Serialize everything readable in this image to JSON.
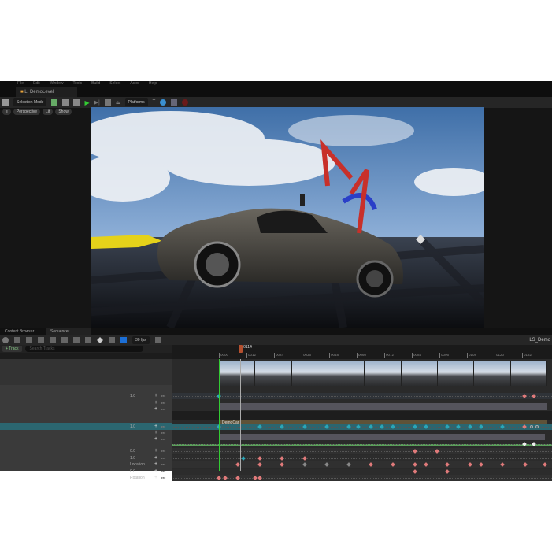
{
  "menu": [
    "File",
    "Edit",
    "Window",
    "Tools",
    "Build",
    "Select",
    "Actor",
    "Help"
  ],
  "level_tab": "L_DemoLevel",
  "toolbar": {
    "mode": "Selection Mode",
    "platforms": "Platforms"
  },
  "viewport_bar": {
    "perspective": "Perspective",
    "lit": "Lit",
    "show": "Show"
  },
  "lower_tabs": {
    "content_browser": "Content Browser",
    "sequencer": "Sequencer"
  },
  "sequencer": {
    "add_track": "+ Track",
    "search_placeholder": "Search Tracks",
    "fps": "30 fps",
    "sequence_name": "LS_Demo",
    "playhead_label": "0114",
    "playhead_frame": 6.5,
    "bar_label": "DemoCar"
  },
  "ruler_ticks": [
    "0000",
    "0012",
    "0024",
    "0036",
    "0048",
    "0060",
    "0072",
    "0084",
    "0096",
    "0108",
    "0120",
    "0132"
  ],
  "tree_rows": [
    {
      "label": "1.0"
    },
    {
      "label": ""
    },
    {
      "label": ""
    },
    {
      "label": "1.0"
    },
    {
      "label": ""
    },
    {
      "label": ""
    },
    {
      "label": "0.0"
    },
    {
      "label": "1.0"
    },
    {
      "label": "Location"
    },
    {
      "label": "0.0"
    },
    {
      "label": "Rotation"
    }
  ],
  "keys": {
    "camera_row": {
      "teal": [
        0
      ],
      "red": [
        93,
        96
      ]
    },
    "car_row": {
      "teal": [
        0,
        12.5,
        19.2,
        26.1,
        32.8,
        39.6,
        42.4,
        46.3,
        49.6,
        53,
        59.7,
        63.1,
        69.5,
        72.9,
        76.5,
        79.9,
        86.3
      ],
      "red": [
        93
      ],
      "circle": [
        95.2,
        96.9
      ]
    },
    "green_row": {
      "white": [
        93,
        96
      ]
    },
    "row_a": {
      "red": [
        59.7,
        66.4
      ]
    },
    "row_b": {
      "teal": [
        7.4
      ],
      "red": [
        12.5,
        19.2,
        26.1
      ]
    },
    "row_c": {
      "red": [
        5.8,
        12.5,
        19.2,
        46.3,
        53,
        59.7,
        63.1,
        69.5,
        76.5,
        79.9,
        86.3,
        93.3,
        99.3
      ],
      "gray": [
        26.1,
        32.8,
        39.6
      ]
    },
    "row_d": {
      "red": [
        59.7,
        69.5
      ]
    },
    "row_e": {
      "red": [
        0,
        1.8,
        5.8,
        11.1,
        12.5
      ]
    }
  },
  "colors": {
    "teal": "#2aa6b8",
    "red": "#e07a7a",
    "green": "#5aa05a",
    "brown": "#5e5238"
  }
}
